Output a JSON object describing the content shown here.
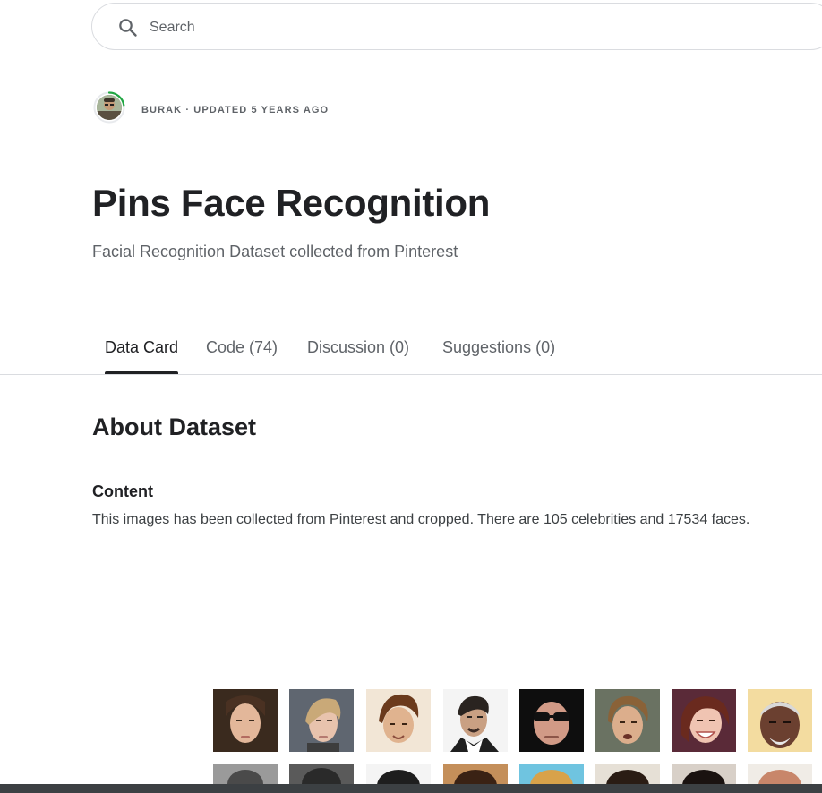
{
  "search": {
    "placeholder": "Search"
  },
  "owner": {
    "line": "BURAK · UPDATED 5 YEARS AGO",
    "ring_color": "#20a642"
  },
  "dataset": {
    "title": "Pins Face Recognition",
    "subtitle": "Facial Recognition Dataset collected from Pinterest"
  },
  "tabs": [
    {
      "label": "Data Card",
      "active": true
    },
    {
      "label": "Code (74)",
      "active": false
    },
    {
      "label": "Discussion (0)",
      "active": false
    },
    {
      "label": "Suggestions (0)",
      "active": false
    }
  ],
  "about": {
    "heading": "About Dataset",
    "content_heading": "Content",
    "content_text": "This images has been collected from Pinterest and cropped. There are 105 celebrities and 17534 faces."
  },
  "icons": {
    "search": "search-icon"
  }
}
